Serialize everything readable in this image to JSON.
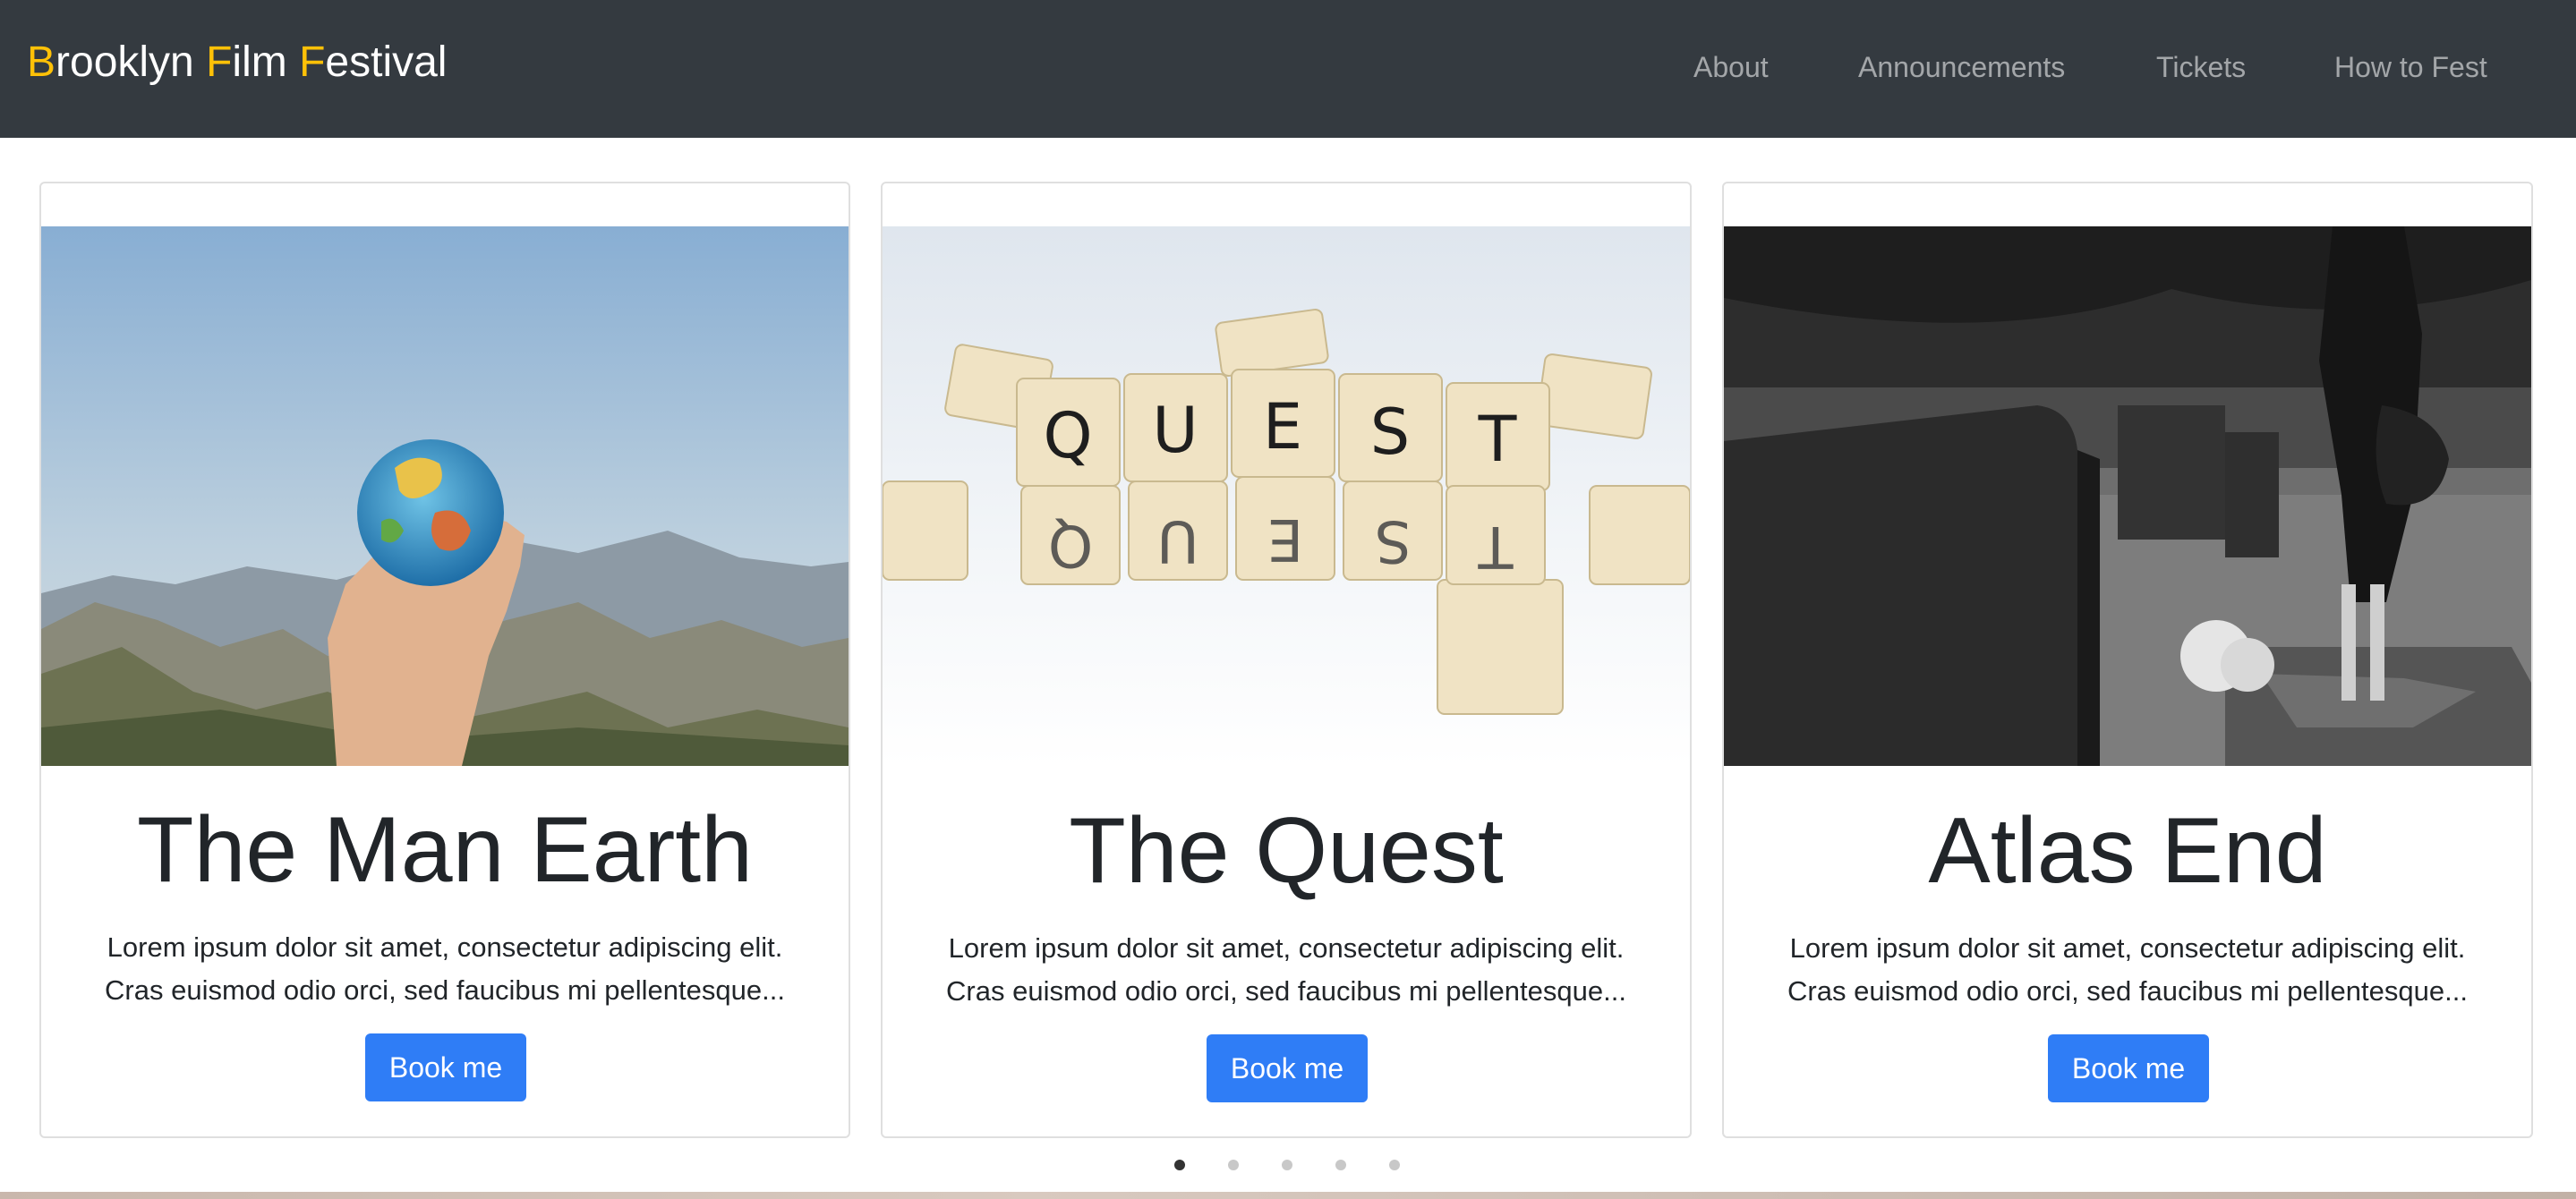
{
  "brand": {
    "parts": [
      {
        "text": "B",
        "accent": true
      },
      {
        "text": "rooklyn ",
        "accent": false
      },
      {
        "text": "F",
        "accent": true
      },
      {
        "text": "ilm ",
        "accent": false
      },
      {
        "text": "F",
        "accent": true
      },
      {
        "text": "estival",
        "accent": false
      }
    ],
    "accent_color": "#ffc107"
  },
  "nav": {
    "items": [
      {
        "label": "About"
      },
      {
        "label": "Announcements"
      },
      {
        "label": "Tickets"
      },
      {
        "label": "How to Fest"
      }
    ]
  },
  "cards": [
    {
      "title": "The Man Earth",
      "text_line1": "Lorem ipsum dolor sit amet, consectetur adipiscing elit.",
      "text_line2": "Cras euismod odio orci, sed faucibus mi pellentesque...",
      "button": "Book me",
      "image": "hand-holding-globe-image"
    },
    {
      "title": "The Quest",
      "text_line1": "Lorem ipsum dolor sit amet, consectetur adipiscing elit.",
      "text_line2": "Cras euismod odio orci, sed faucibus mi pellentesque...",
      "button": "Book me",
      "image": "letter-tiles-quest-image"
    },
    {
      "title": "Atlas End",
      "text_line1": "Lorem ipsum dolor sit amet, consectetur adipiscing elit.",
      "text_line2": "Cras euismod odio orci, sed faucibus mi pellentesque...",
      "button": "Book me",
      "image": "cemetery-mourner-image"
    }
  ],
  "carousel": {
    "slide_count": 5,
    "active_index": 0
  },
  "colors": {
    "navbar": "#343a40",
    "button": "#2f7df6",
    "nav_link": "rgba(255,255,255,0.55)"
  }
}
